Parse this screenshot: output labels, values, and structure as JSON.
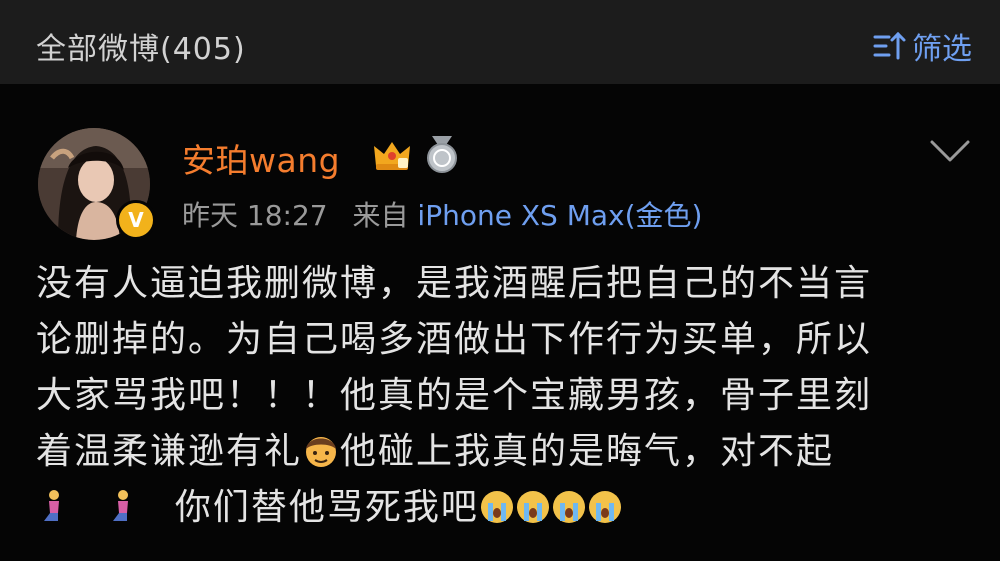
{
  "header": {
    "title": "全部微博(405)",
    "filter_label": "筛选",
    "filter_icon": "sort-filter-icon"
  },
  "post": {
    "username": "安珀wang",
    "badges": [
      "crown-vip-icon",
      "silver-medal-icon"
    ],
    "verified_badge": "V",
    "time": "昨天 18:27",
    "from_label": "来自",
    "source": "iPhone XS Max(金色)",
    "more_icon": "chevron-down-icon",
    "content_lines": [
      "没有人逼迫我删微博，是我酒醒后把自己的不当言",
      "论删掉的。为自己喝多酒做出下作行为买单，所以",
      "大家骂我吧！！！他真的是个宝藏男孩，骨子里刻"
    ],
    "line4_before_emoji": "着温柔谦逊有礼",
    "line4_after_emoji": "他碰上我真的是晦气，对不起",
    "line5_text": "你们替他骂死我吧",
    "emojis": [
      "boy-emoji",
      "kneeling-woman-emoji",
      "kneeling-woman-emoji",
      "crying-face-emoji",
      "crying-face-emoji",
      "crying-face-emoji",
      "crying-face-emoji"
    ],
    "colors": {
      "username": "#f57d2e",
      "link": "#6f9ff0",
      "vip": "#f2b21b"
    }
  }
}
